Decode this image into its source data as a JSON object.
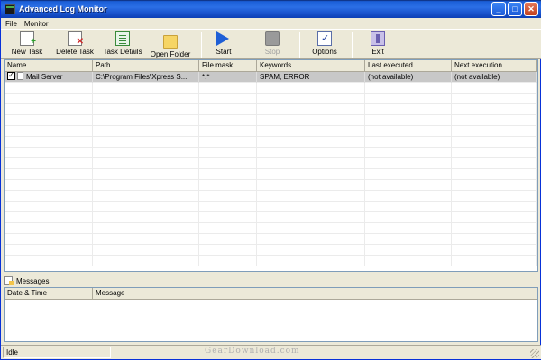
{
  "window": {
    "title": "Advanced Log Monitor"
  },
  "title_buttons": {
    "minimize": "_",
    "maximize": "□",
    "close": "✕"
  },
  "menu": {
    "file": "File",
    "monitor": "Monitor"
  },
  "toolbar": {
    "new_task": "New Task",
    "delete_task": "Delete Task",
    "task_details": "Task Details",
    "open_folder": "Open Folder",
    "start": "Start",
    "stop": "Stop",
    "options": "Options",
    "exit": "Exit"
  },
  "tasks": {
    "columns": [
      "Name",
      "Path",
      "File mask",
      "Keywords",
      "Last executed",
      "Next execution"
    ],
    "rows": [
      {
        "checked": true,
        "name": "Mail Server",
        "path": "C:\\Program Files\\Xpress S...",
        "file_mask": "*.*",
        "keywords": "SPAM, ERROR",
        "last_executed": "(not available)",
        "next_execution": "(not available)"
      }
    ]
  },
  "messages": {
    "label": "Messages",
    "columns": [
      "Date & Time",
      "Message"
    ]
  },
  "status": {
    "text": "Idle",
    "watermark": "GearDownload.com"
  },
  "icons": {
    "app": "app-monitor-icon",
    "new_task": "new-document-icon",
    "delete_task": "delete-document-icon",
    "task_details": "details-list-icon",
    "open_folder": "folder-icon",
    "start": "play-icon",
    "stop": "stop-icon",
    "options": "checklist-icon",
    "exit": "exit-door-icon",
    "messages": "messages-icon"
  }
}
